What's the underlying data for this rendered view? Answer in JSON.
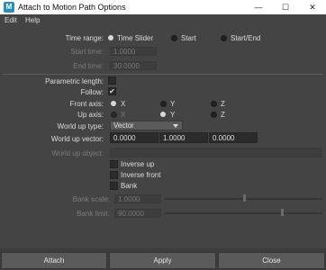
{
  "window": {
    "app_icon_letter": "M",
    "title": "Attach to Motion Path Options",
    "minimize_glyph": "—",
    "maximize_glyph": "☐",
    "close_glyph": "✕"
  },
  "menu": {
    "edit": "Edit",
    "help": "Help"
  },
  "time_range": {
    "label": "Time range:",
    "options": [
      "Time Slider",
      "Start",
      "Start/End"
    ],
    "selected": "Time Slider"
  },
  "start_time": {
    "label": "Start time:",
    "value": "1.0000"
  },
  "end_time": {
    "label": "End time:",
    "value": "30.0000"
  },
  "parametric_length": {
    "label": "Parametric length:",
    "checked": false
  },
  "follow": {
    "label": "Follow:",
    "checked": true,
    "check_glyph": "✔"
  },
  "front_axis": {
    "label": "Front axis:",
    "options": [
      "X",
      "Y",
      "Z"
    ],
    "selected": "X"
  },
  "up_axis": {
    "label": "Up axis:",
    "options": [
      "X",
      "Y",
      "Z"
    ],
    "selected": "Y"
  },
  "world_up_type": {
    "label": "World up type:",
    "value": "Vector"
  },
  "world_up_vector": {
    "label": "World up vector:",
    "values": [
      "0.0000",
      "1.0000",
      "0.0000"
    ]
  },
  "world_up_object": {
    "label": "World up object:",
    "value": ""
  },
  "inverse_up": {
    "label": "Inverse up",
    "checked": false
  },
  "inverse_front": {
    "label": "Inverse front",
    "checked": false
  },
  "bank": {
    "label": "Bank",
    "checked": false
  },
  "bank_scale": {
    "label": "Bank scale:",
    "value": "1.0000",
    "slider_fraction": 0.5
  },
  "bank_limit": {
    "label": "Bank limit:",
    "value": "90.0000",
    "slider_fraction": 0.74
  },
  "buttons": {
    "attach": "Attach",
    "apply": "Apply",
    "close": "Close"
  },
  "colors": {
    "background": "#444444",
    "titlebar": "#ffffff",
    "field": "#2b2b2b",
    "disabled_text": "#7b7b7b"
  },
  "icons": {
    "app": "maya-icon",
    "radio": "radio-dot",
    "check": "check-mark"
  }
}
